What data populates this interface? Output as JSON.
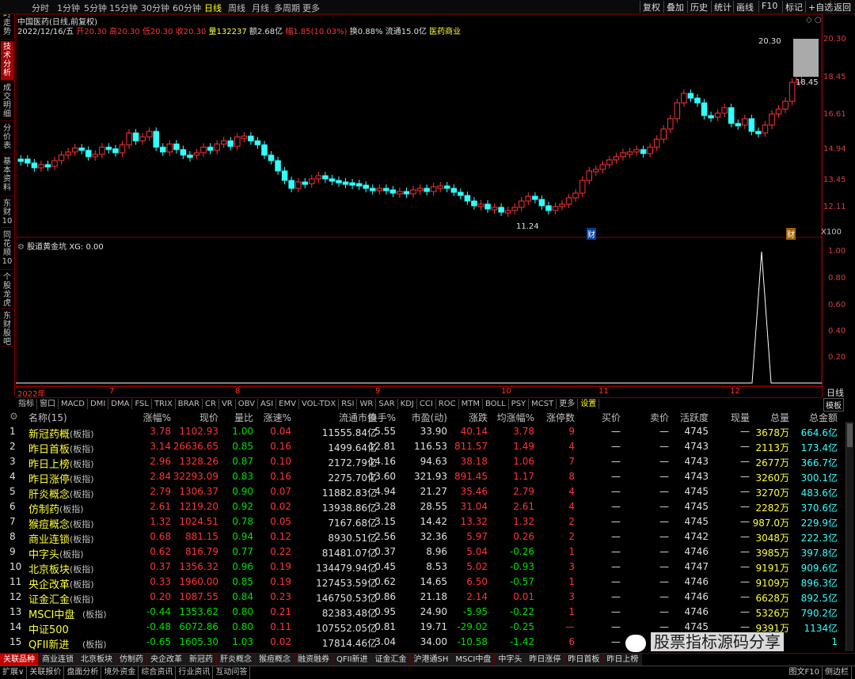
{
  "side_tabs": [
    "分时走势",
    "技术分析",
    "成交明细",
    "分价表",
    "基本资料",
    "东财10",
    "同花顺10",
    "个股龙虎",
    "东财股吧"
  ],
  "periods": [
    "分时",
    "1分钟",
    "5分钟",
    "15分钟",
    "30分钟",
    "60分钟",
    "日线",
    "周线",
    "月线",
    "多周期",
    "更多"
  ],
  "toolbar_right": [
    "复权",
    "叠加",
    "历史",
    "统计",
    "画线",
    "F10",
    "标记",
    "+自选",
    "返回"
  ],
  "stock": {
    "title": "中国医药(日线,前复权)",
    "date": "2022/12/16/五",
    "open": "开20.30",
    "high": "高20.30",
    "low": "低20.30",
    "close": "收20.30",
    "vol": "量132237",
    "amt": "额2.68亿",
    "chg": "幅1.85(10.03%)",
    "turnover": "换0.88%",
    "float": "流通15.0亿",
    "sector": "医药商业"
  },
  "price_axis": [
    "20.30",
    "18.45",
    "16.61",
    "14.94",
    "13.45",
    "12.11"
  ],
  "price_labels": {
    "hi": "20.30",
    "close": "18.45",
    "low": "11.24"
  },
  "indicator": {
    "title": "股道黄金坑 XG: 0.00",
    "axis": [
      "1.00",
      "0.80",
      "0.60",
      "0.40",
      "0.20"
    ]
  },
  "time_axis": [
    "2022年",
    "7",
    "8",
    "9",
    "10",
    "11",
    "12"
  ],
  "marks": {
    "x100": "X100",
    "cai1": "财",
    "cai2": "财",
    "day": "日线",
    "moban": "模板"
  },
  "ind_tabs": [
    "指标",
    "窗口",
    "MACD",
    "DMI",
    "DMA",
    "FSL",
    "TRIX",
    "BRAR",
    "CR",
    "VR",
    "OBV",
    "ASI",
    "EMV",
    "VOL-TDX",
    "RSI",
    "WR",
    "SAR",
    "KDJ",
    "CCI",
    "ROC",
    "MTM",
    "BOLL",
    "PSY",
    "MCST",
    "更多",
    "设置"
  ],
  "table": {
    "headers": [
      "名称(15)",
      "涨幅%",
      "现价",
      "量比",
      "涨速%",
      "流通市值",
      "换手%",
      "市盈(动)",
      "涨跌",
      "均涨幅%",
      "涨停数",
      "买价",
      "卖价",
      "活跃度",
      "现量",
      "总量",
      "总金额"
    ],
    "rows": [
      [
        "1",
        "新冠药概",
        "(板指)",
        "3.78",
        "1102.93",
        "1.00",
        "0.04",
        "11555.84亿",
        "5.55",
        "33.90",
        "40.14",
        "3.78",
        "9",
        "—",
        "—",
        "4745",
        "—",
        "3678万",
        "664.6亿"
      ],
      [
        "2",
        "昨日首板",
        "(板指)",
        "3.14",
        "26636.65",
        "0.85",
        "0.16",
        "1499.64亿",
        "12.81",
        "116.53",
        "811.57",
        "1.49",
        "4",
        "—",
        "—",
        "4743",
        "—",
        "2113万",
        "173.4亿"
      ],
      [
        "3",
        "昨日上榜",
        "(板指)",
        "2.96",
        "1328.26",
        "0.87",
        "0.10",
        "2172.79亿",
        "14.16",
        "94.63",
        "38.18",
        "1.06",
        "7",
        "—",
        "—",
        "4743",
        "—",
        "2677万",
        "366.7亿"
      ],
      [
        "4",
        "昨日涨停",
        "(板指)",
        "2.84",
        "32293.09",
        "0.83",
        "0.16",
        "2275.70亿",
        "13.60",
        "321.93",
        "891.45",
        "1.17",
        "8",
        "—",
        "—",
        "4743",
        "—",
        "3260万",
        "300.1亿"
      ],
      [
        "5",
        "肝炎概念",
        "(板指)",
        "2.79",
        "1306.37",
        "0.90",
        "0.07",
        "11882.83亿",
        "4.94",
        "21.27",
        "35.46",
        "2.79",
        "4",
        "—",
        "—",
        "4745",
        "—",
        "3270万",
        "483.6亿"
      ],
      [
        "6",
        "仿制药",
        "(板指)",
        "2.61",
        "1219.20",
        "0.92",
        "0.02",
        "13938.86亿",
        "3.28",
        "28.55",
        "31.04",
        "2.61",
        "4",
        "—",
        "—",
        "4745",
        "—",
        "2282万",
        "370.6亿"
      ],
      [
        "7",
        "猴痘概念",
        "(板指)",
        "1.32",
        "1024.51",
        "0.78",
        "0.05",
        "7167.68亿",
        "3.15",
        "14.42",
        "13.32",
        "1.32",
        "2",
        "—",
        "—",
        "4745",
        "—",
        "987.0万",
        "229.9亿"
      ],
      [
        "8",
        "商业连锁",
        "(板指)",
        "0.68",
        "881.15",
        "0.94",
        "0.12",
        "8930.51亿",
        "2.56",
        "32.36",
        "5.97",
        "0.26",
        "2",
        "—",
        "—",
        "4742",
        "—",
        "3048万",
        "222.3亿"
      ],
      [
        "9",
        "中字头",
        "(板指)",
        "0.62",
        "816.79",
        "0.77",
        "0.22",
        "81481.07亿",
        "0.37",
        "8.96",
        "5.04",
        "-0.26",
        "1",
        "—",
        "—",
        "4746",
        "—",
        "3985万",
        "397.8亿"
      ],
      [
        "10",
        "北京板块",
        "(板指)",
        "0.37",
        "1356.32",
        "0.96",
        "0.19",
        "134479.94亿",
        "0.45",
        "8.53",
        "5.02",
        "-0.93",
        "3",
        "—",
        "—",
        "4747",
        "—",
        "9191万",
        "909.6亿"
      ],
      [
        "11",
        "央企改革",
        "(板指)",
        "0.33",
        "1960.00",
        "0.85",
        "0.19",
        "127453.59亿",
        "0.62",
        "14.65",
        "6.50",
        "-0.57",
        "1",
        "—",
        "—",
        "4746",
        "—",
        "9109万",
        "896.3亿"
      ],
      [
        "12",
        "证金汇金",
        "(板指)",
        "0.20",
        "1087.55",
        "0.84",
        "0.23",
        "146750.53亿",
        "0.86",
        "21.18",
        "2.14",
        "0.01",
        "3",
        "—",
        "—",
        "4746",
        "—",
        "6628万",
        "892.5亿"
      ],
      [
        "13",
        "MSCI中盘",
        "(板指)",
        "-0.44",
        "1353.62",
        "0.80",
        "0.21",
        "82383.48亿",
        "0.95",
        "24.90",
        "-5.95",
        "-0.22",
        "1",
        "—",
        "—",
        "4746",
        "—",
        "5326万",
        "790.2亿"
      ],
      [
        "14",
        "中证500",
        "",
        "-0.48",
        "6072.86",
        "0.80",
        "0.11",
        "107552.05亿",
        "0.81",
        "19.71",
        "-29.02",
        "-0.25",
        "—",
        "—",
        "—",
        "4745",
        "—",
        "9391万",
        "1134亿"
      ],
      [
        "15",
        "QFII新进",
        "(板指)",
        "-0.65",
        "1605.30",
        "1.03",
        "0.02",
        "17814.46亿",
        "3.04",
        "34.00",
        "-10.58",
        "-1.42",
        "6",
        "—",
        "—",
        "4745",
        "—",
        "",
        "1"
      ]
    ]
  },
  "bottom_tabs": [
    "关联品种",
    "商业连锁",
    "北京板块",
    "仿制药",
    "央企改革",
    "新冠药",
    "肝炎概念",
    "猴痘概念",
    "融资融券",
    "QFII新进",
    "证金汇金",
    "沪港通SH",
    "MSCI中盘",
    "中字头",
    "昨日涨停",
    "昨日首板",
    "昨日上榜"
  ],
  "status": [
    "扩展∨",
    "关联报价",
    "盘面分析",
    "境外资金",
    "综合资讯",
    "行业资讯",
    "互动问答"
  ],
  "status_right": [
    "图文F10",
    "侧边栏"
  ],
  "watermark": "股票指标源码分享",
  "colors": {
    "up": "#ff3333",
    "down": "#33ffff",
    "bg": "#000000",
    "frame": "#a00000"
  }
}
